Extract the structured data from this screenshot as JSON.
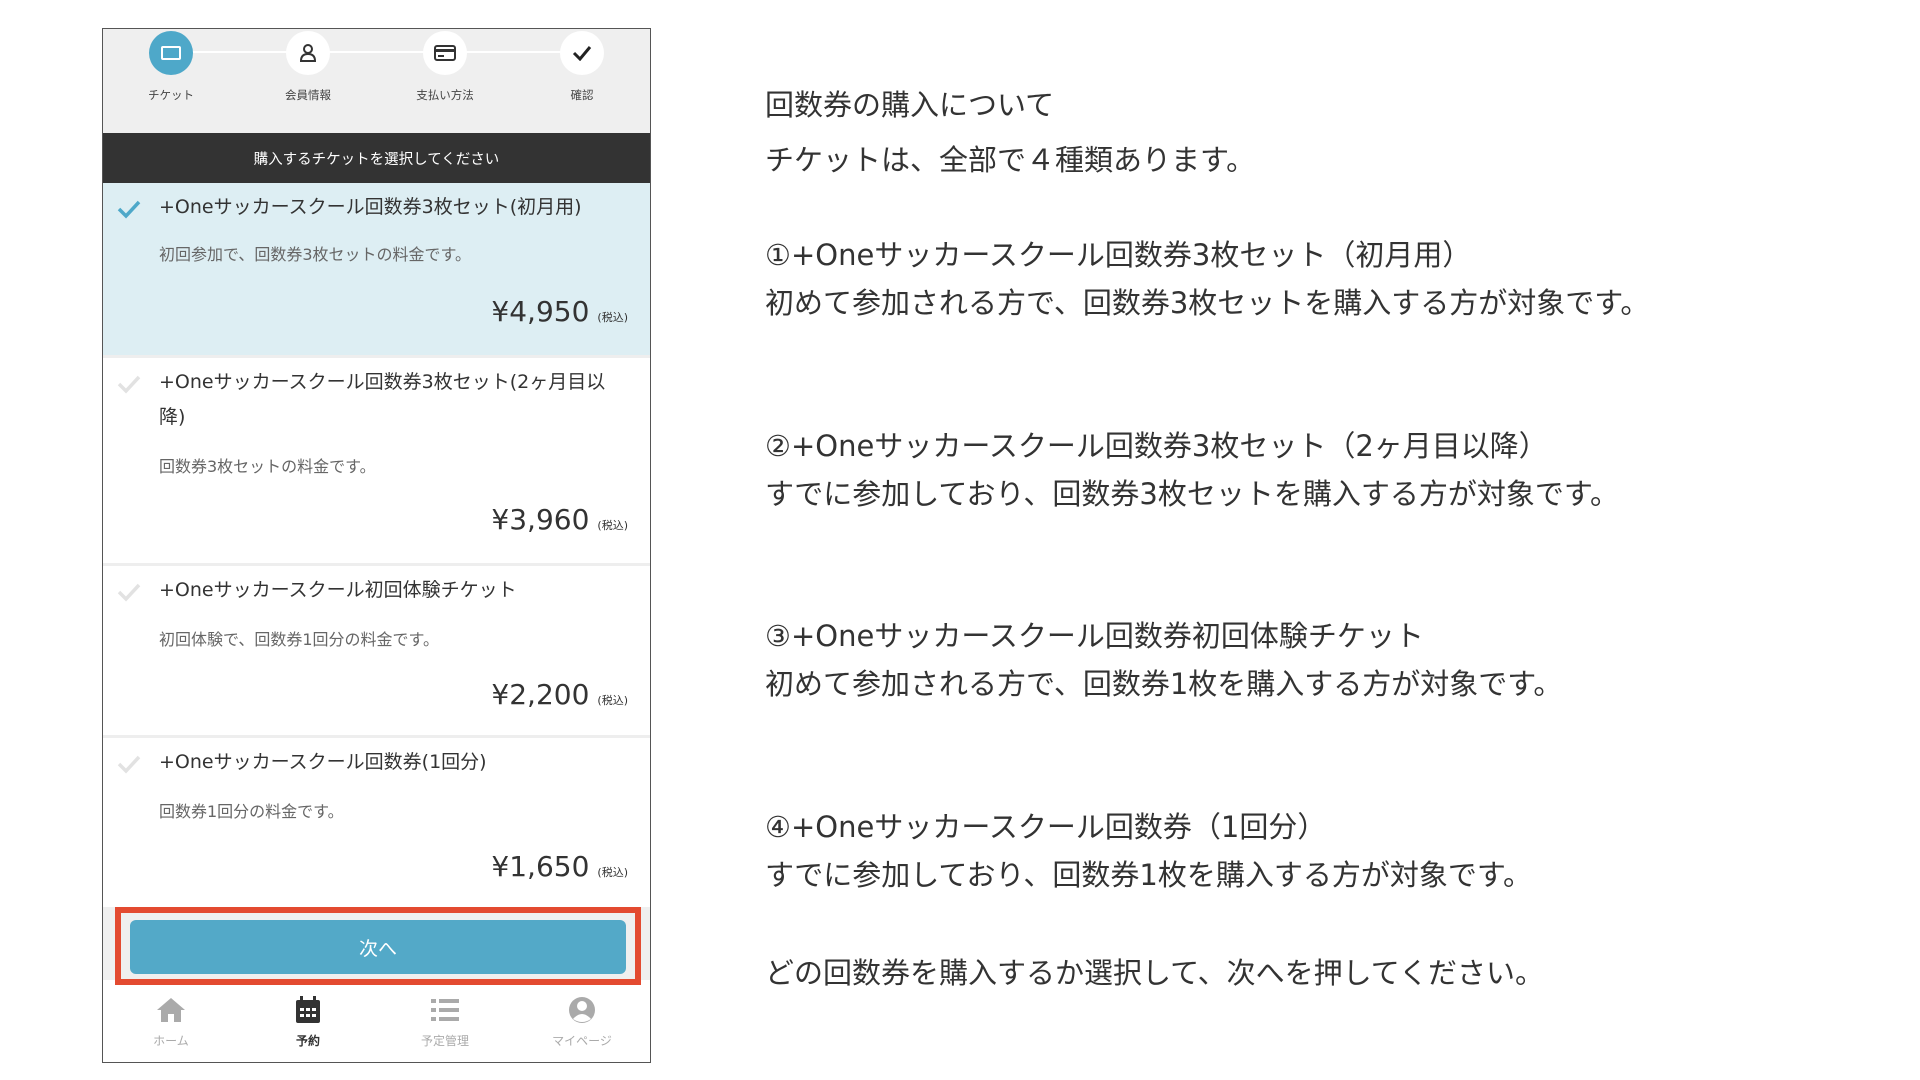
{
  "stepper": {
    "steps": [
      {
        "label": "チケット",
        "icon": "ticket-icon",
        "active": true
      },
      {
        "label": "会員情報",
        "icon": "user-icon",
        "active": false
      },
      {
        "label": "支払い方法",
        "icon": "credit-card-icon",
        "active": false
      },
      {
        "label": "確認",
        "icon": "check-icon",
        "active": false
      }
    ],
    "active_color": "#4ea8c9"
  },
  "banner": {
    "text": "購入するチケットを選択してください"
  },
  "tickets": [
    {
      "title": "+Oneサッカースクール回数券3枚セット(初月用)",
      "description": "初回参加で、回数券3枚セットの料金です。",
      "price": "¥4,950",
      "tax": "(税込)",
      "selected": true
    },
    {
      "title": "+Oneサッカースクール回数券3枚セット(2ヶ月目以降)",
      "description": "回数券3枚セットの料金です。",
      "price": "¥3,960",
      "tax": "(税込)",
      "selected": false
    },
    {
      "title": "+Oneサッカースクール初回体験チケット",
      "description": "初回体験で、回数券1回分の料金です。",
      "price": "¥2,200",
      "tax": "(税込)",
      "selected": false
    },
    {
      "title": "+Oneサッカースクール回数券(1回分)",
      "description": "回数券1回分の料金です。",
      "price": "¥1,650",
      "tax": "(税込)",
      "selected": false
    }
  ],
  "next_button": {
    "label": "次へ",
    "color": "#53a9c8",
    "highlight_color": "#e34a30"
  },
  "tabbar": {
    "tabs": [
      {
        "label": "ホーム",
        "icon": "home-icon",
        "active": false
      },
      {
        "label": "予約",
        "icon": "calendar-icon",
        "active": true
      },
      {
        "label": "予定管理",
        "icon": "list-icon",
        "active": false
      },
      {
        "label": "マイページ",
        "icon": "account-icon",
        "active": false
      }
    ]
  },
  "explanation": {
    "heading": "回数券の購入について",
    "intro": "チケットは、全部で４種類あります。",
    "item1_title": "①+Oneサッカースクール回数券3枚セット（初月用）",
    "item1_desc": "初めて参加される方で、回数券3枚セットを購入する方が対象です。",
    "item2_title": "②+Oneサッカースクール回数券3枚セット（2ヶ月目以降）",
    "item2_desc": "すでに参加しており、回数券3枚セットを購入する方が対象です。",
    "item3_title": "③+Oneサッカースクール回数券初回体験チケット",
    "item3_desc": "初めて参加される方で、回数券1枚を購入する方が対象です。",
    "item4_title": "④+Oneサッカースクール回数券（1回分）",
    "item4_desc": "すでに参加しており、回数券1枚を購入する方が対象です。",
    "closing": "どの回数券を購入するか選択して、次へを押してください。"
  }
}
